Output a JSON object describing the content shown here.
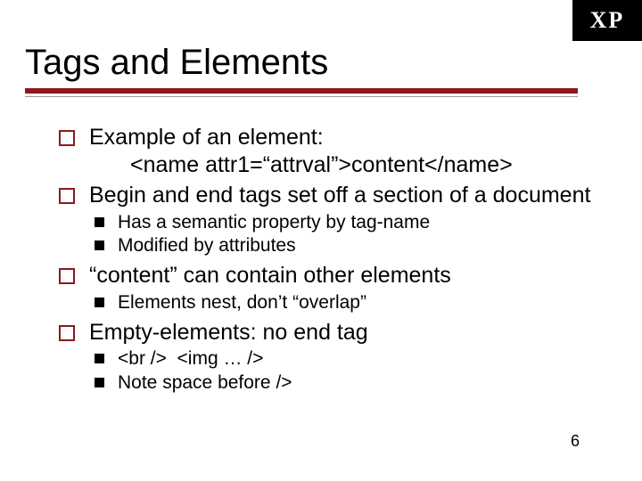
{
  "corner_label": "XP",
  "title": "Tags and Elements",
  "page_number": "6",
  "bullets": {
    "b1_line1": "Example of an element:",
    "b1_line2": "<name attr1=“attrval”>content</name>",
    "b2": "Begin and end tags set off a section of a document",
    "b2_sub1": "Has a semantic property by tag-name",
    "b2_sub2": "Modified by attributes",
    "b3": "“content” can contain other elements",
    "b3_sub1": "Elements nest, don’t “overlap”",
    "b4": "Empty-elements: no end tag",
    "b4_sub1": "<br />  <img … />",
    "b4_sub2": "Note space before />"
  }
}
